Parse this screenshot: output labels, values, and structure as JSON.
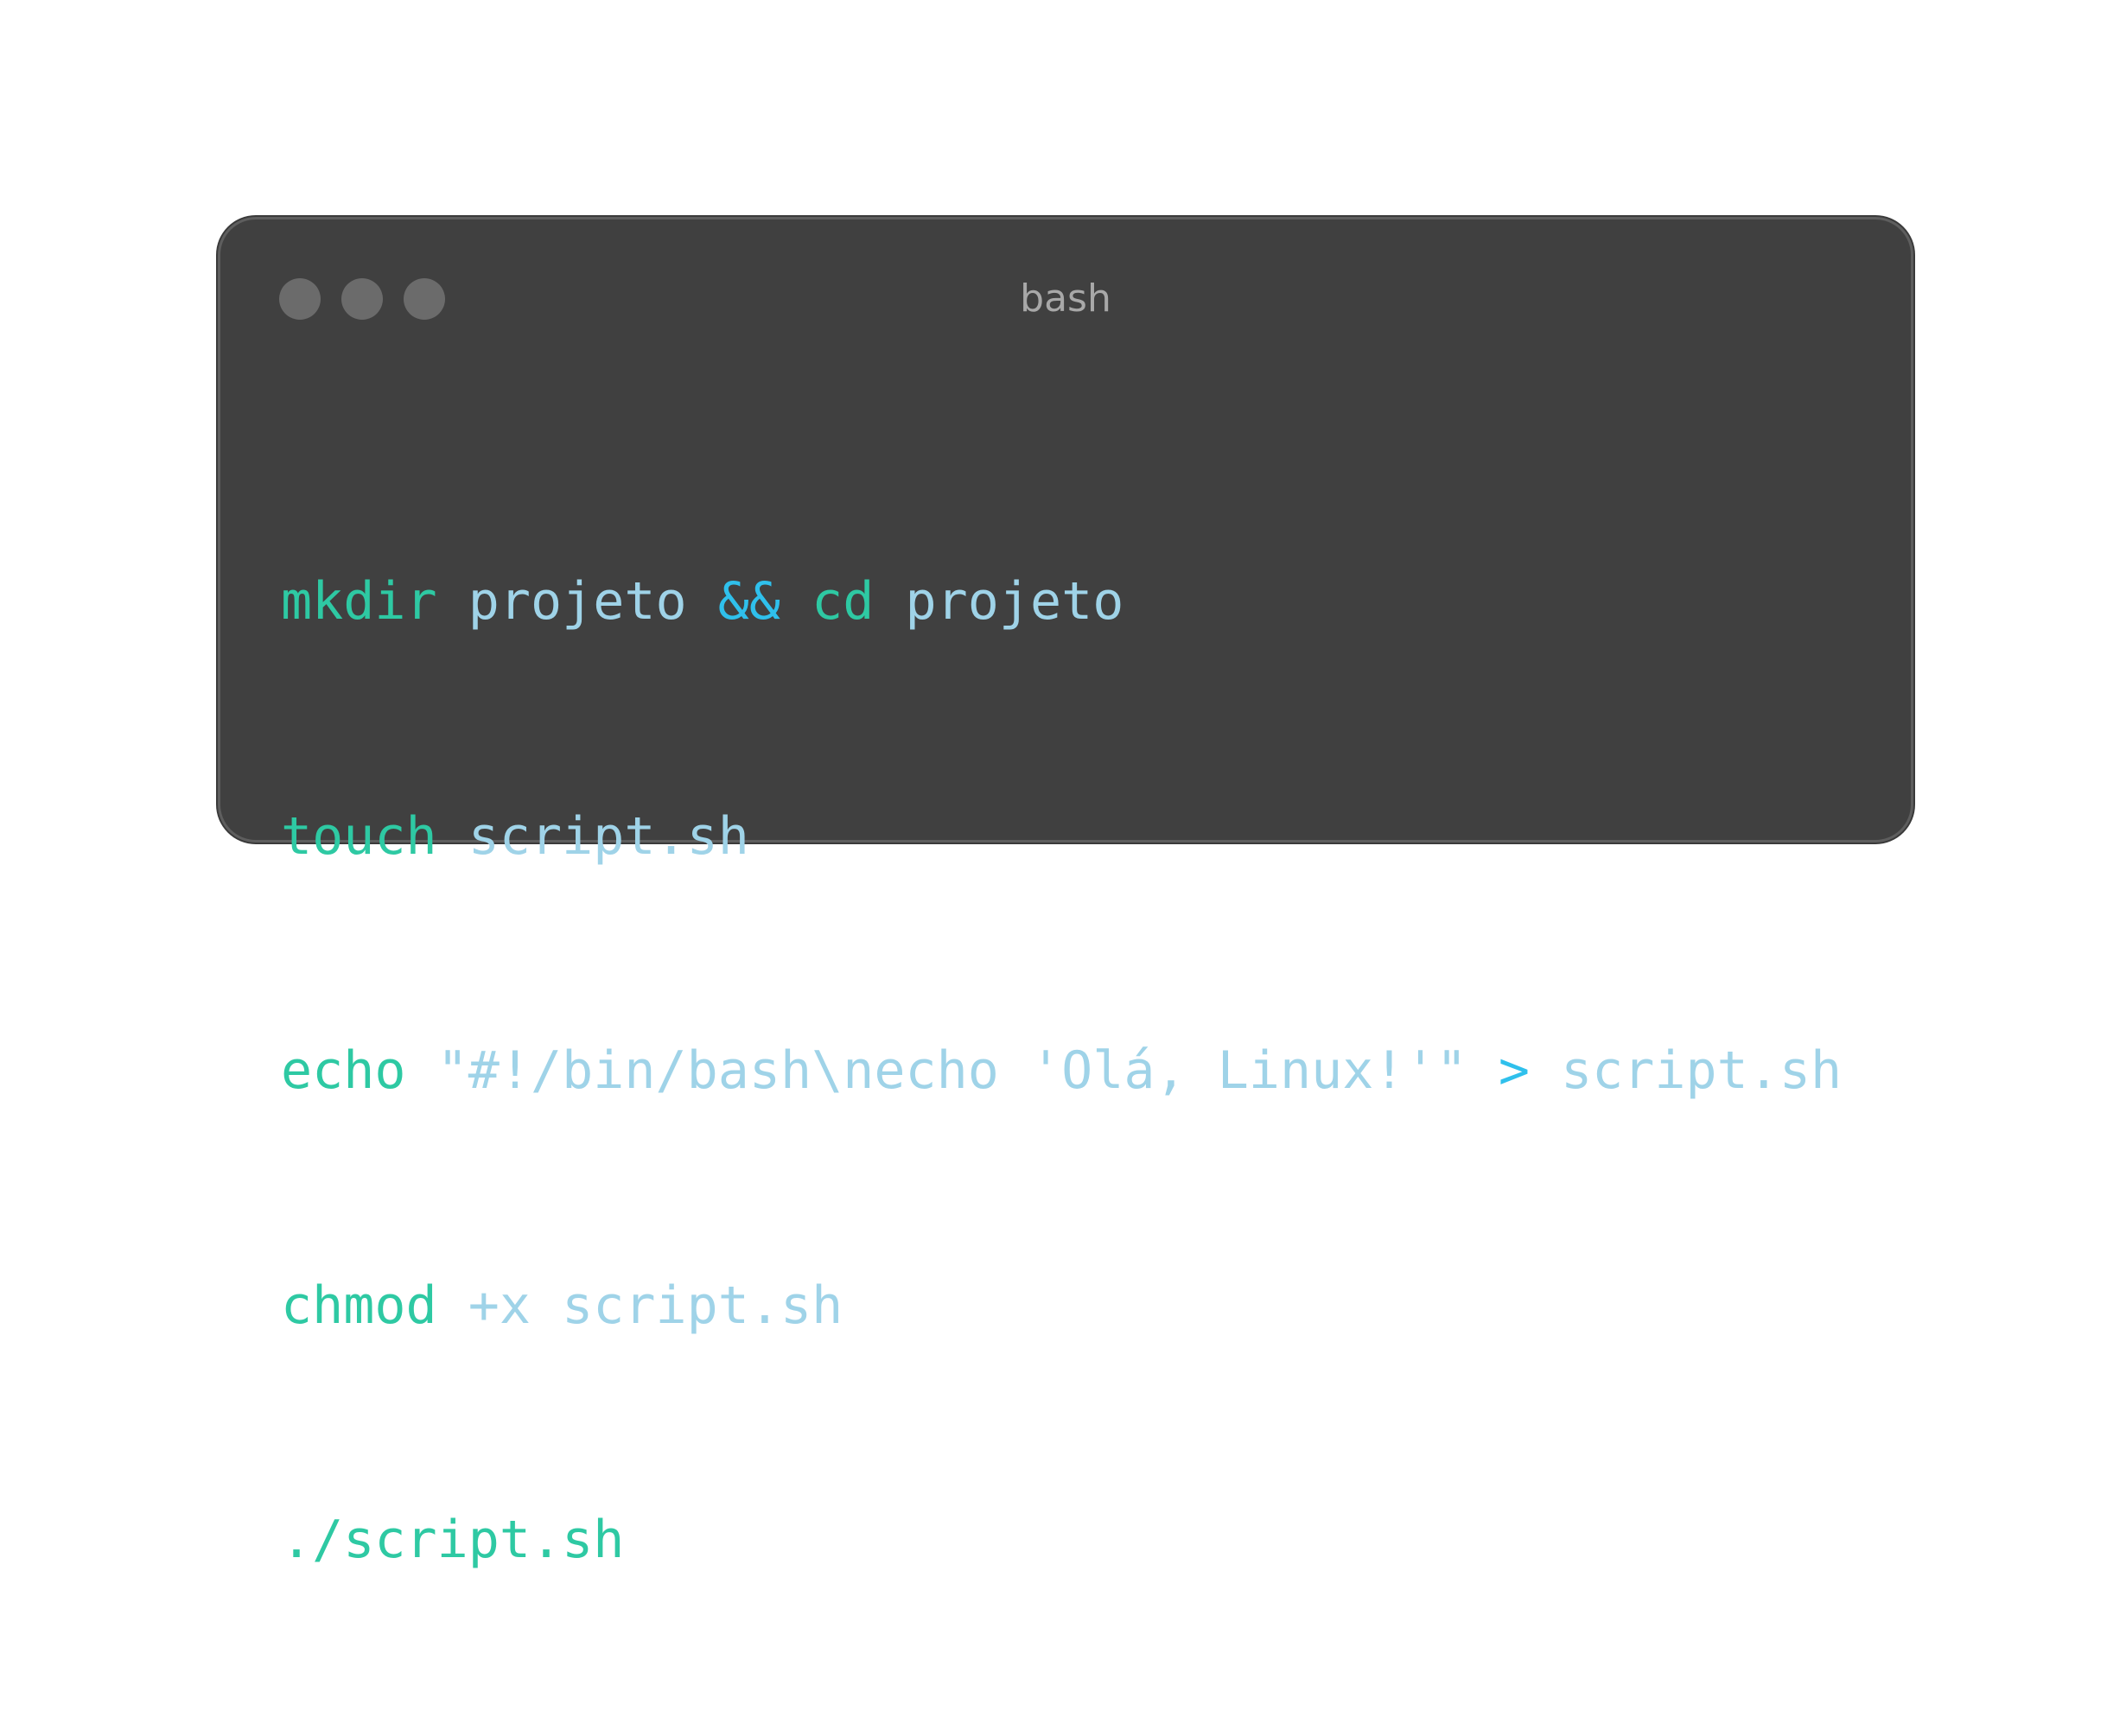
{
  "window": {
    "title": "bash",
    "colors": {
      "background": "#404040",
      "command": "#2ec9a3",
      "argument": "#9fd3e8",
      "operator": "#2fc0ec",
      "title": "#a8a8a8",
      "traffic_dot": "#6b6b6b"
    }
  },
  "code": {
    "lines": [
      {
        "cmd1": "mkdir",
        "arg1": "projeto",
        "op": "&&",
        "cmd2": "cd",
        "arg2": "projeto"
      },
      {
        "cmd": "touch",
        "arg": "script.sh"
      },
      {
        "cmd": "echo",
        "arg": "\"#!/bin/bash\\necho 'Olá, Linux!'\"",
        "op": ">",
        "target": "script.sh"
      },
      {
        "cmd": "chmod",
        "arg": "+x script.sh"
      },
      {
        "cmd": "./script.sh"
      }
    ]
  }
}
